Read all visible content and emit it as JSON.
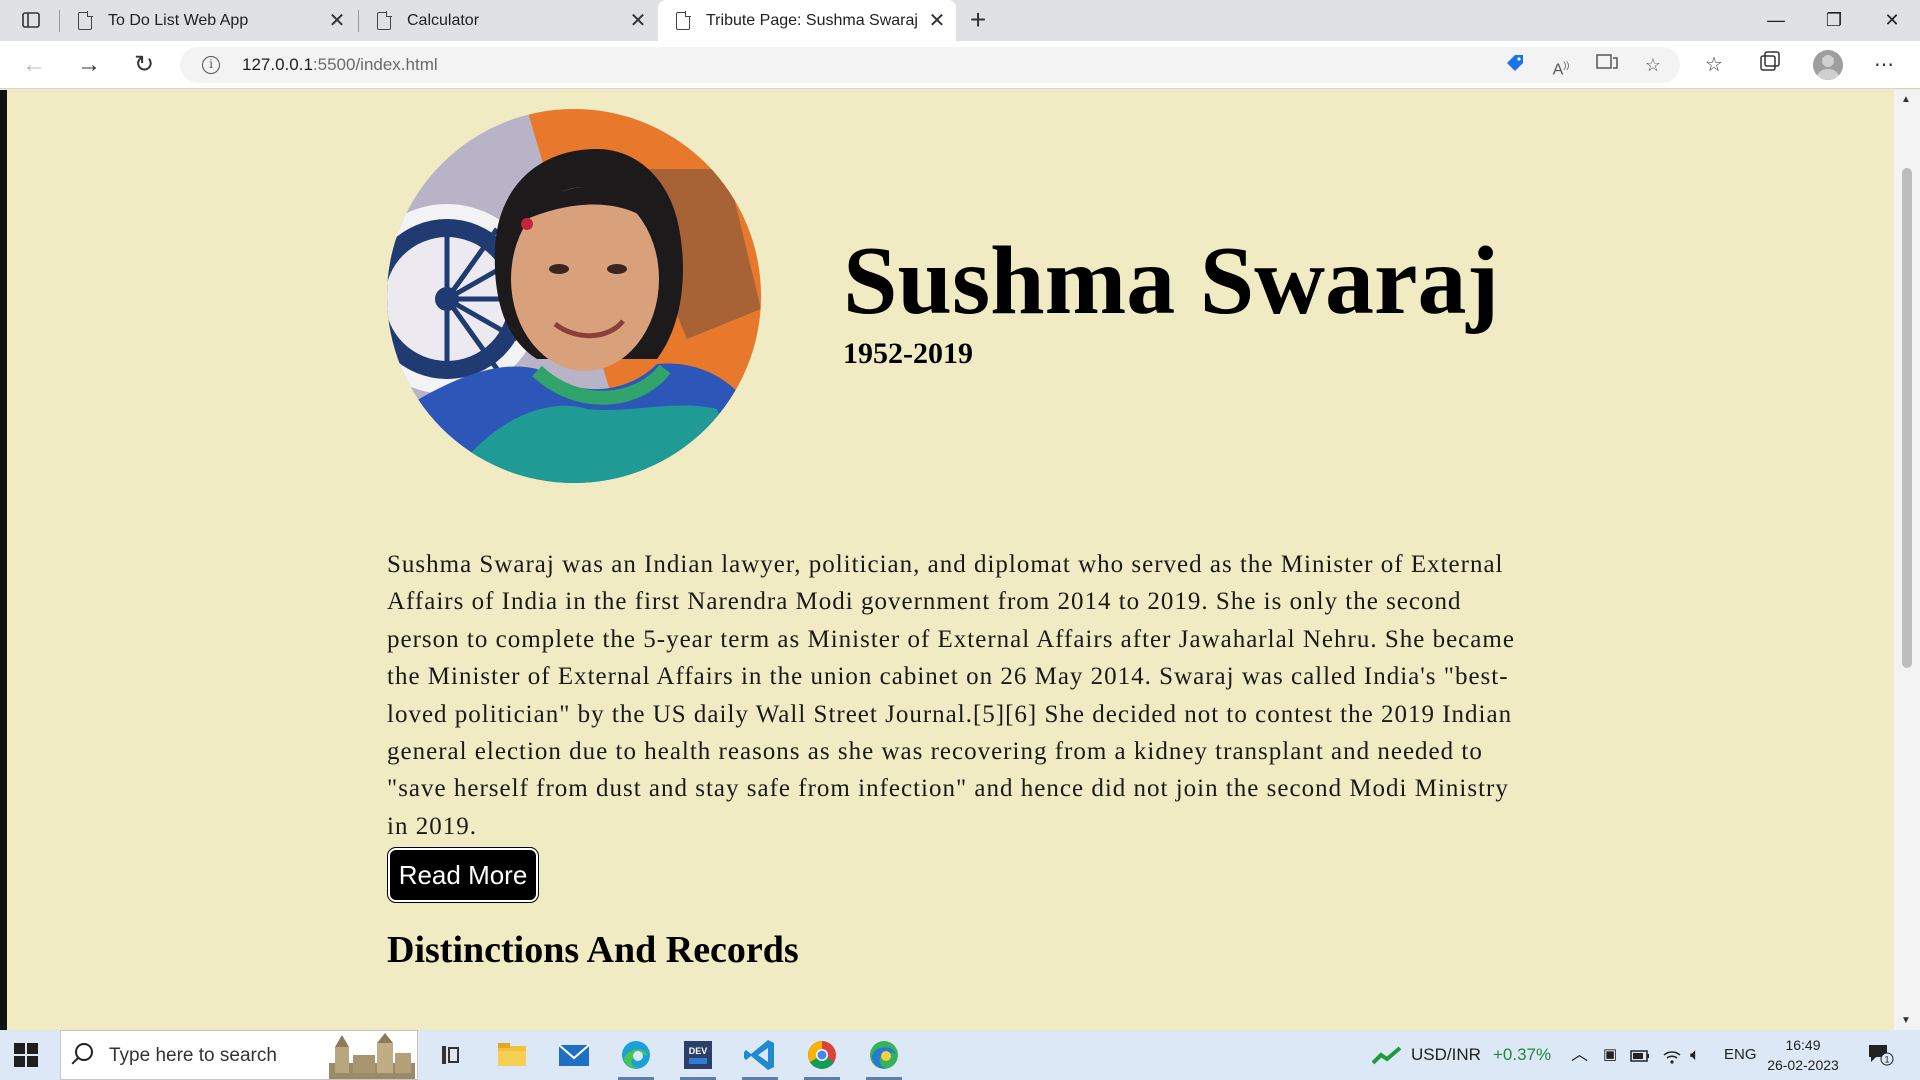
{
  "browser": {
    "tabs": [
      {
        "title": "To Do List Web App",
        "active": false
      },
      {
        "title": "Calculator",
        "active": false
      },
      {
        "title": "Tribute Page: Sushma Swaraj",
        "active": true
      }
    ],
    "new_tab_icon": "plus-icon",
    "window_controls": {
      "minimize": "—",
      "restore": "❐",
      "close": "✕"
    },
    "url_host": "127.0.0.1",
    "url_rest": ":5500/index.html",
    "nav": {
      "back": "←",
      "forward": "→",
      "reload": "↻"
    }
  },
  "page": {
    "name": "Sushma Swaraj",
    "years": "1952-2019",
    "bio": "Sushma Swaraj was an Indian lawyer, politician, and diplomat who served as the Minister of External Affairs of India in the first Narendra Modi government from 2014 to 2019. She is only the second person to complete the 5-year term as Minister of External Affairs after Jawaharlal Nehru. She became the Minister of External Affairs in the union cabinet on 26 May 2014. Swaraj was called India's \"best-loved politician\" by the US daily Wall Street Journal.[5][6] She decided not to contest the 2019 Indian general election due to health reasons as she was recovering from a kidney transplant and needed to \"save herself from dust and stay safe from infection\" and hence did not join the second Modi Ministry in 2019.",
    "read_more_label": "Read More",
    "section_title": "Distinctions And Records",
    "colors": {
      "background": "#f0ebc3",
      "button": "#000000"
    }
  },
  "taskbar": {
    "search_placeholder": "Type here to search",
    "ticker_name": "USD/INR",
    "ticker_change": "+0.37%",
    "language": "ENG",
    "time": "16:49",
    "date": "26-02-2023",
    "notification_count": "1"
  }
}
